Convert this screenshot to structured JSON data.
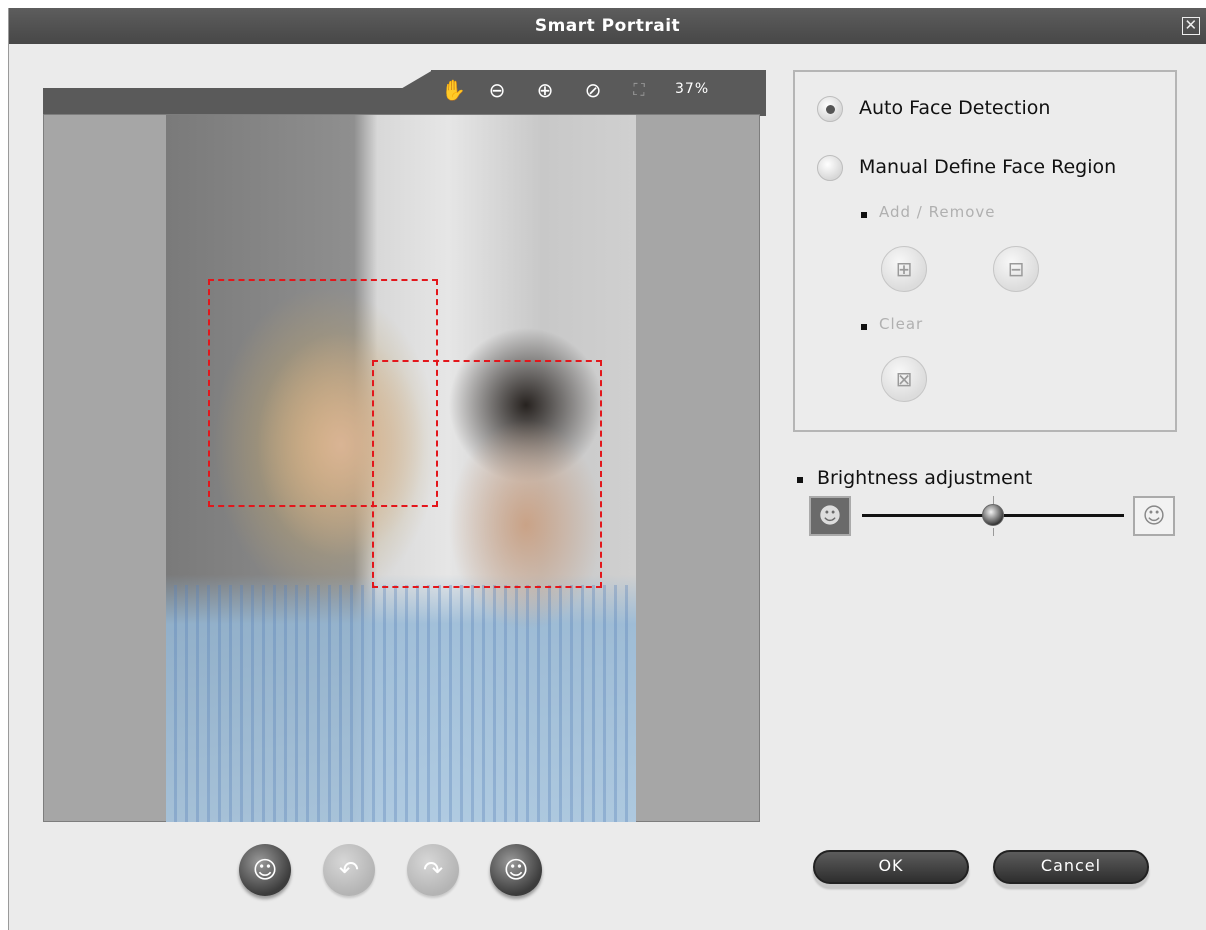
{
  "window": {
    "title": "Smart Portrait",
    "close_icon": "close-icon"
  },
  "viewer": {
    "tools": [
      {
        "name": "hand-tool-icon",
        "glyph": "✋"
      },
      {
        "name": "zoom-out-icon",
        "glyph": "⊖"
      },
      {
        "name": "zoom-in-icon",
        "glyph": "⊕"
      },
      {
        "name": "reset-icon",
        "glyph": "⊘"
      },
      {
        "name": "fit-to-window-icon",
        "glyph": "⛶"
      }
    ],
    "zoom_level": "37%",
    "bottom_buttons": [
      {
        "name": "detect-faces-icon",
        "glyph": "☺",
        "state": "active"
      },
      {
        "name": "undo-icon",
        "glyph": "↶",
        "state": "disabled"
      },
      {
        "name": "redo-icon",
        "glyph": "↷",
        "state": "disabled"
      },
      {
        "name": "smile-icon",
        "glyph": "☺",
        "state": "active"
      }
    ]
  },
  "face_panel": {
    "auto_label": "Auto Face Detection",
    "manual_label": "Manual Define Face Region",
    "add_remove_label": "Add / Remove",
    "clear_label": "Clear",
    "selected_mode": "auto"
  },
  "brightness": {
    "label": "Brightness adjustment",
    "value_fraction": 0.5
  },
  "actions": {
    "ok_label": "OK",
    "cancel_label": "Cancel"
  },
  "colors": {
    "titlebar": "#4e4e4e",
    "face_box": "#e3161b",
    "panel_bg": "#ebebeb"
  }
}
